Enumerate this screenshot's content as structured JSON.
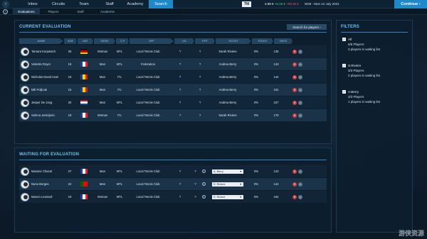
{
  "nav": {
    "tabs": [
      "Inbox",
      "Circuits",
      "Team",
      "Staff",
      "Academy",
      "Search"
    ],
    "active_tab": "Search",
    "brand": "TM",
    "money": "2.99 €",
    "delta_pos": "+6.15 €",
    "delta_neg": "+99.3k €",
    "date": "W28 - Mon 12 July 2021",
    "continue_label": "Continue"
  },
  "subnav": {
    "help": "?",
    "tabs": [
      "Evaluations",
      "Players",
      "Staff",
      "Academie"
    ],
    "active_tab": "Evaluations"
  },
  "current": {
    "title": "CURRENT EVALUATION",
    "search_label": "Search for players",
    "columns": [
      "NAME",
      "AGE",
      "NAT",
      "GEND",
      "C.P",
      "APP",
      "LVL",
      "POT",
      "SCOUT",
      "STUDY",
      "DAYS"
    ],
    "rows": [
      {
        "name": "Tamara Korpatsch",
        "age": "25",
        "flag": "de",
        "gender": "Woman",
        "cp": "MTL",
        "app": "Local Tennis Club",
        "lvl": "?",
        "pot": "?",
        "scout": "Sarah Riviere",
        "study": "0%",
        "days": "135"
      },
      {
        "name": "Valentin Royer",
        "age": "19",
        "flag": "fr",
        "gender": "Man",
        "cp": "MTL",
        "app": "Federation",
        "lvl": "?",
        "pot": "?",
        "scout": "Andrea Berry",
        "study": "0%",
        "days": "143"
      },
      {
        "name": "Nicholas David Ionel",
        "age": "18",
        "flag": "ro",
        "gender": "Man",
        "cp": "ITL",
        "app": "Local Tennis Club",
        "lvl": "?",
        "pot": "?",
        "scout": "Andrea Berry",
        "study": "0%",
        "days": "144"
      },
      {
        "name": "Mili Poljicak",
        "age": "16",
        "flag": "ro",
        "gender": "Man",
        "cp": "ITL",
        "app": "Local Tennis Club",
        "lvl": "?",
        "pot": "?",
        "scout": "Andrea Berry",
        "study": "0%",
        "days": "161"
      },
      {
        "name": "Jesper De Jong",
        "age": "20",
        "flag": "nl",
        "gender": "Man",
        "cp": "MTL",
        "app": "Local Tennis Club",
        "lvl": "?",
        "pot": "?",
        "scout": "Andrea Berry",
        "study": "0%",
        "days": "157"
      },
      {
        "name": "Selena Janicijevic",
        "age": "18",
        "flag": "fr",
        "gender": "Woman",
        "cp": "ITL",
        "app": "Local Tennis Club",
        "lvl": "?",
        "pot": "?",
        "scout": "Sarah Riviere",
        "study": "0%",
        "days": "170"
      }
    ]
  },
  "waiting": {
    "title": "WAITING FOR EVALUATION",
    "rows": [
      {
        "name": "Maxime Chazal",
        "age": "27",
        "flag": "fr",
        "gender": "Man",
        "cp": "MTL",
        "app": "Local Tennis Club",
        "lvl": "?",
        "pot": "?",
        "scout": "A. Berry",
        "study": "0%",
        "days": "123"
      },
      {
        "name": "Nuno Borges",
        "age": "24",
        "flag": "pt",
        "gender": "Man",
        "cp": "MTL",
        "app": "Local Tennis Club",
        "lvl": "?",
        "pot": "?",
        "scout": "S. Riviere",
        "study": "0%",
        "days": "144"
      },
      {
        "name": "Manon Leonard",
        "age": "19",
        "flag": "fr",
        "gender": "Woman",
        "cp": "MTL",
        "app": "Local Tennis Club",
        "lvl": "?",
        "pot": "?",
        "scout": "S. Riviere",
        "study": "0%",
        "days": "164"
      }
    ]
  },
  "filters": {
    "title": "FILTERS",
    "groups": [
      {
        "label": "All",
        "players": "6/6 Players",
        "waiting": "3 players in waiting list"
      },
      {
        "label": "S.Riviere",
        "players": "3/3 Players",
        "waiting": "2 players in waiting list"
      },
      {
        "label": "A.Berry",
        "players": "3/3 Players",
        "waiting": "1 players in waiting list"
      }
    ]
  },
  "flags": {
    "de": [
      "#111111",
      "#d00000",
      "#ffce00"
    ],
    "fr": [
      "#1f3f99",
      "#ffffff",
      "#e0262f"
    ],
    "ro": [
      "#1b3f9a",
      "#ffd200",
      "#d2231f"
    ],
    "nl": [
      "#c8102e",
      "#ffffff",
      "#21468b"
    ],
    "pt": [
      "#006600",
      "#006600",
      "#ff0000"
    ]
  },
  "watermark": "游侠资源"
}
